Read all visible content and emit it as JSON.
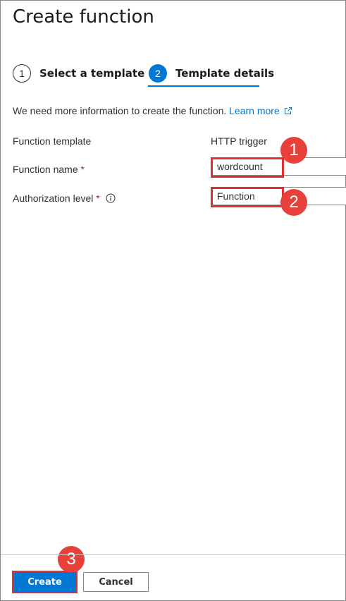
{
  "panel": {
    "title": "Create function"
  },
  "steps": [
    {
      "number": "1",
      "label": "Select a template"
    },
    {
      "number": "2",
      "label": "Template details"
    }
  ],
  "info": {
    "text": "We need more information to create the function.",
    "link": "Learn more"
  },
  "form": {
    "template_label": "Function template",
    "template_value": "HTTP trigger",
    "name_label": "Function name",
    "name_value": "wordcount",
    "auth_label": "Authorization level",
    "auth_value": "Function",
    "required_mark": "*"
  },
  "callouts": [
    "1",
    "2",
    "3"
  ],
  "footer": {
    "create_label": "Create",
    "cancel_label": "Cancel"
  },
  "colors": {
    "accent": "#0078d4",
    "highlight": "#e02f33",
    "badge": "#e8403a",
    "required": "#a4262c"
  }
}
